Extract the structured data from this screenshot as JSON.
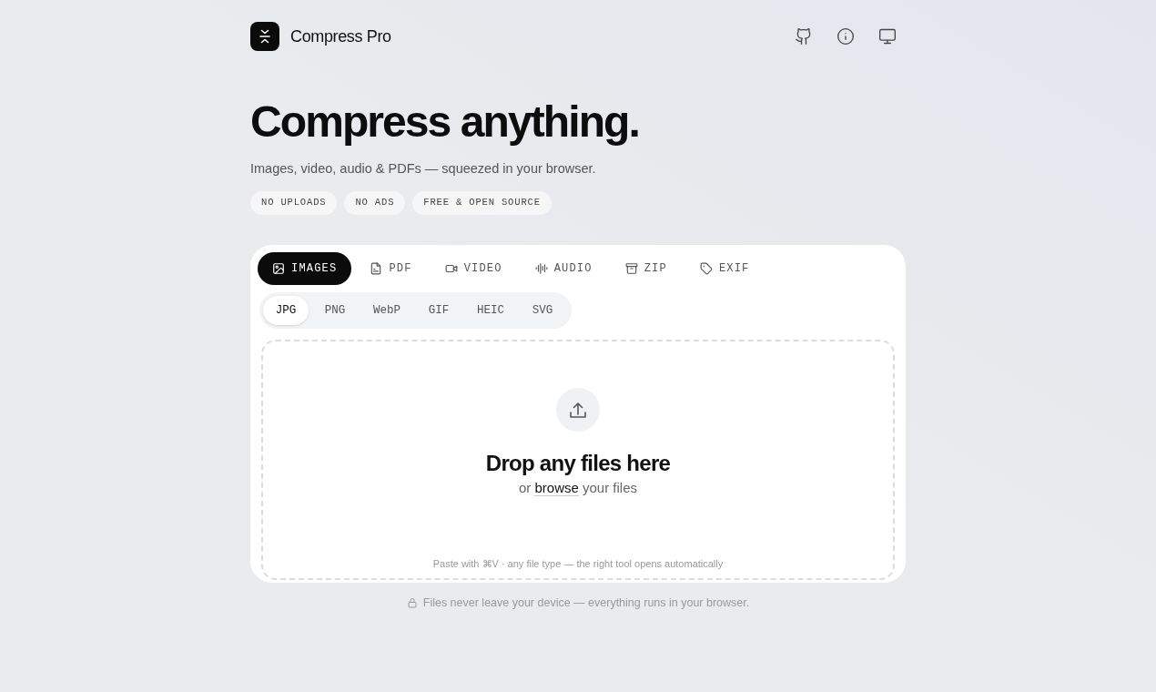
{
  "header": {
    "brand": "Compress Pro"
  },
  "hero": {
    "title": "Compress anything.",
    "subtitle": "Images, video, audio & PDFs — squeezed in your browser.",
    "badges": [
      "NO UPLOADS",
      "NO ADS",
      "FREE & OPEN SOURCE"
    ]
  },
  "tabs": [
    {
      "label": "IMAGES",
      "selected": true
    },
    {
      "label": "PDF",
      "selected": false
    },
    {
      "label": "VIDEO",
      "selected": false
    },
    {
      "label": "AUDIO",
      "selected": false
    },
    {
      "label": "ZIP",
      "selected": false
    },
    {
      "label": "EXIF",
      "selected": false
    }
  ],
  "formats": [
    {
      "label": "JPG",
      "selected": true
    },
    {
      "label": "PNG",
      "selected": false
    },
    {
      "label": "WebP",
      "selected": false
    },
    {
      "label": "GIF",
      "selected": false
    },
    {
      "label": "HEIC",
      "selected": false
    },
    {
      "label": "SVG",
      "selected": false
    }
  ],
  "dropzone": {
    "title": "Drop any files here",
    "prompt_before": "or",
    "link": "browse",
    "prompt_after": "your files",
    "hint": "Paste with ⌘V · any file type — the right tool opens automatically"
  },
  "footer_note": "Files never leave your device — everything runs in your browser."
}
